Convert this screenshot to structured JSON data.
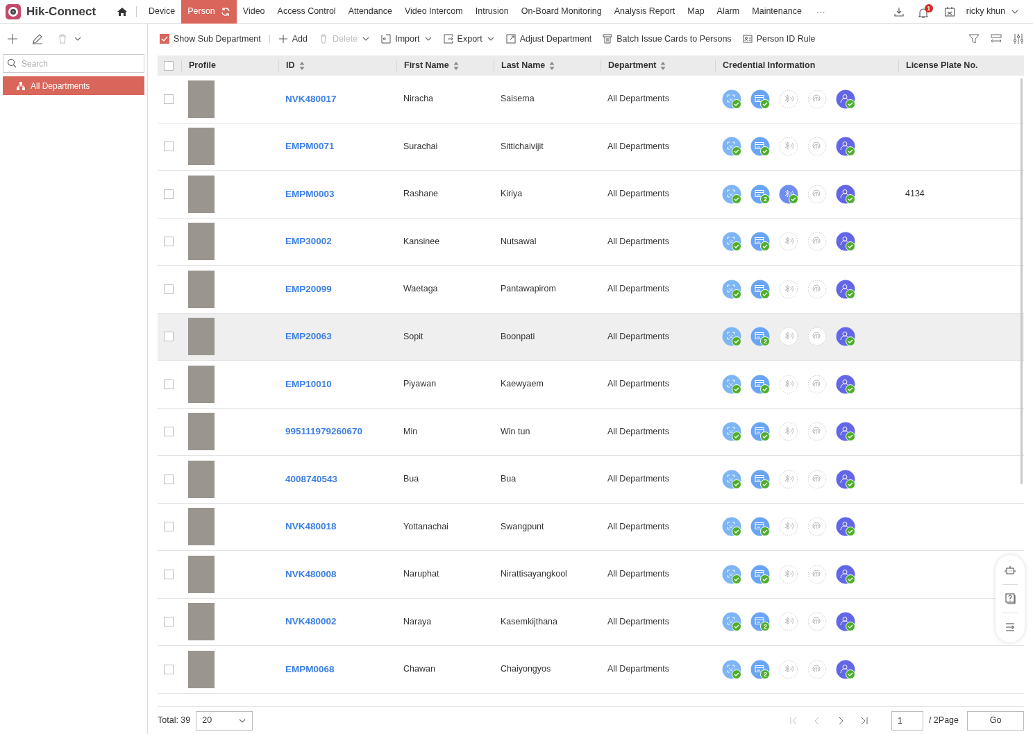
{
  "app": {
    "name": "Hik-Connect"
  },
  "nav": [
    {
      "label": "Device",
      "selected": false
    },
    {
      "label": "Person",
      "selected": true
    },
    {
      "label": "Video",
      "selected": false
    },
    {
      "label": "Access Control",
      "selected": false
    },
    {
      "label": "Attendance",
      "selected": false
    },
    {
      "label": "Video Intercom",
      "selected": false
    },
    {
      "label": "Intrusion",
      "selected": false
    },
    {
      "label": "On-Board Monitoring",
      "selected": false
    },
    {
      "label": "Analysis Report",
      "selected": false
    },
    {
      "label": "Map",
      "selected": false
    },
    {
      "label": "Alarm",
      "selected": false
    },
    {
      "label": "Maintenance",
      "selected": false
    }
  ],
  "nav_more": "···",
  "notifications": "1",
  "user": "ricky khun",
  "sidebar": {
    "search": {
      "placeholder": "Search"
    },
    "items": [
      {
        "label": "All Departments",
        "selected": true
      }
    ]
  },
  "toolbar": {
    "show_sub_department": {
      "label": "Show Sub Department",
      "checked": true
    },
    "actions": [
      {
        "label": "Add",
        "kind": "add",
        "disabled": false,
        "dropdown": false
      },
      {
        "label": "Delete",
        "kind": "delete",
        "disabled": true,
        "dropdown": true
      },
      {
        "label": "Import",
        "kind": "import",
        "disabled": false,
        "dropdown": true
      },
      {
        "label": "Export",
        "kind": "export",
        "disabled": false,
        "dropdown": true
      },
      {
        "label": "Adjust Department",
        "kind": "adjust",
        "disabled": false,
        "dropdown": false
      },
      {
        "label": "Batch Issue Cards to Persons",
        "kind": "cards",
        "disabled": false,
        "dropdown": false
      },
      {
        "label": "Person ID Rule",
        "kind": "rule",
        "disabled": false,
        "dropdown": false
      }
    ]
  },
  "table": {
    "select_all": {
      "checked": false
    },
    "columns": [
      {
        "label": "Profile",
        "sortable": false
      },
      {
        "label": "ID",
        "sortable": true
      },
      {
        "label": "First Name",
        "sortable": true
      },
      {
        "label": "Last Name",
        "sortable": true
      },
      {
        "label": "Department",
        "sortable": true
      },
      {
        "label": "Credential Information",
        "sortable": false
      },
      {
        "label": "License Plate No.",
        "sortable": false
      }
    ],
    "rows": [
      {
        "id": "NVK480017",
        "first": "Niracha",
        "last": "Saisema",
        "department": "All Departments",
        "plate": "",
        "hovered": false,
        "bluetooth": false,
        "cards": ""
      },
      {
        "id": "EMPM0071",
        "first": "Surachai",
        "last": "Sittichaivijit",
        "department": "All Departments",
        "plate": "",
        "hovered": false,
        "bluetooth": false,
        "cards": ""
      },
      {
        "id": "EMPM0003",
        "first": "Rashane",
        "last": "Kiriya",
        "department": "All Departments",
        "plate": "4134",
        "hovered": false,
        "bluetooth": true,
        "cards": "2"
      },
      {
        "id": "EMP30002",
        "first": "Kansinee",
        "last": "Nutsawal",
        "department": "All Departments",
        "plate": "",
        "hovered": false,
        "bluetooth": false,
        "cards": ""
      },
      {
        "id": "EMP20099",
        "first": "Waetaga",
        "last": "Pantawapirom",
        "department": "All Departments",
        "plate": "",
        "hovered": false,
        "bluetooth": false,
        "cards": ""
      },
      {
        "id": "EMP20063",
        "first": "Sopit",
        "last": "Boonpati",
        "department": "All Departments",
        "plate": "",
        "hovered": true,
        "bluetooth": false,
        "cards": "2"
      },
      {
        "id": "EMP10010",
        "first": "Piyawan",
        "last": "Kaewyaem",
        "department": "All Departments",
        "plate": "",
        "hovered": false,
        "bluetooth": false,
        "cards": ""
      },
      {
        "id": "995111979260670",
        "first": "Min",
        "last": "Win tun",
        "department": "All Departments",
        "plate": "",
        "hovered": false,
        "bluetooth": false,
        "cards": ""
      },
      {
        "id": "4008740543",
        "first": "Bua",
        "last": "Bua",
        "department": "All Departments",
        "plate": "",
        "hovered": false,
        "bluetooth": false,
        "cards": ""
      },
      {
        "id": "NVK480018",
        "first": "Yottanachai",
        "last": "Swangpunt",
        "department": "All Departments",
        "plate": "",
        "hovered": false,
        "bluetooth": false,
        "cards": ""
      },
      {
        "id": "NVK480008",
        "first": "Naruphat",
        "last": "Nirattisayangkool",
        "department": "All Departments",
        "plate": "",
        "hovered": false,
        "bluetooth": false,
        "cards": ""
      },
      {
        "id": "NVK480002",
        "first": "Naraya",
        "last": "Kasemkijthana",
        "department": "All Departments",
        "plate": "",
        "hovered": false,
        "bluetooth": false,
        "cards": "2"
      },
      {
        "id": "EMPM0068",
        "first": "Chawan",
        "last": "Chaiyongyos",
        "department": "All Departments",
        "plate": "",
        "hovered": false,
        "bluetooth": false,
        "cards": "2"
      }
    ]
  },
  "pagination": {
    "total": "Total: 39",
    "page_size": "20",
    "page": "1",
    "pages": "/ 2Page",
    "go": "Go"
  }
}
